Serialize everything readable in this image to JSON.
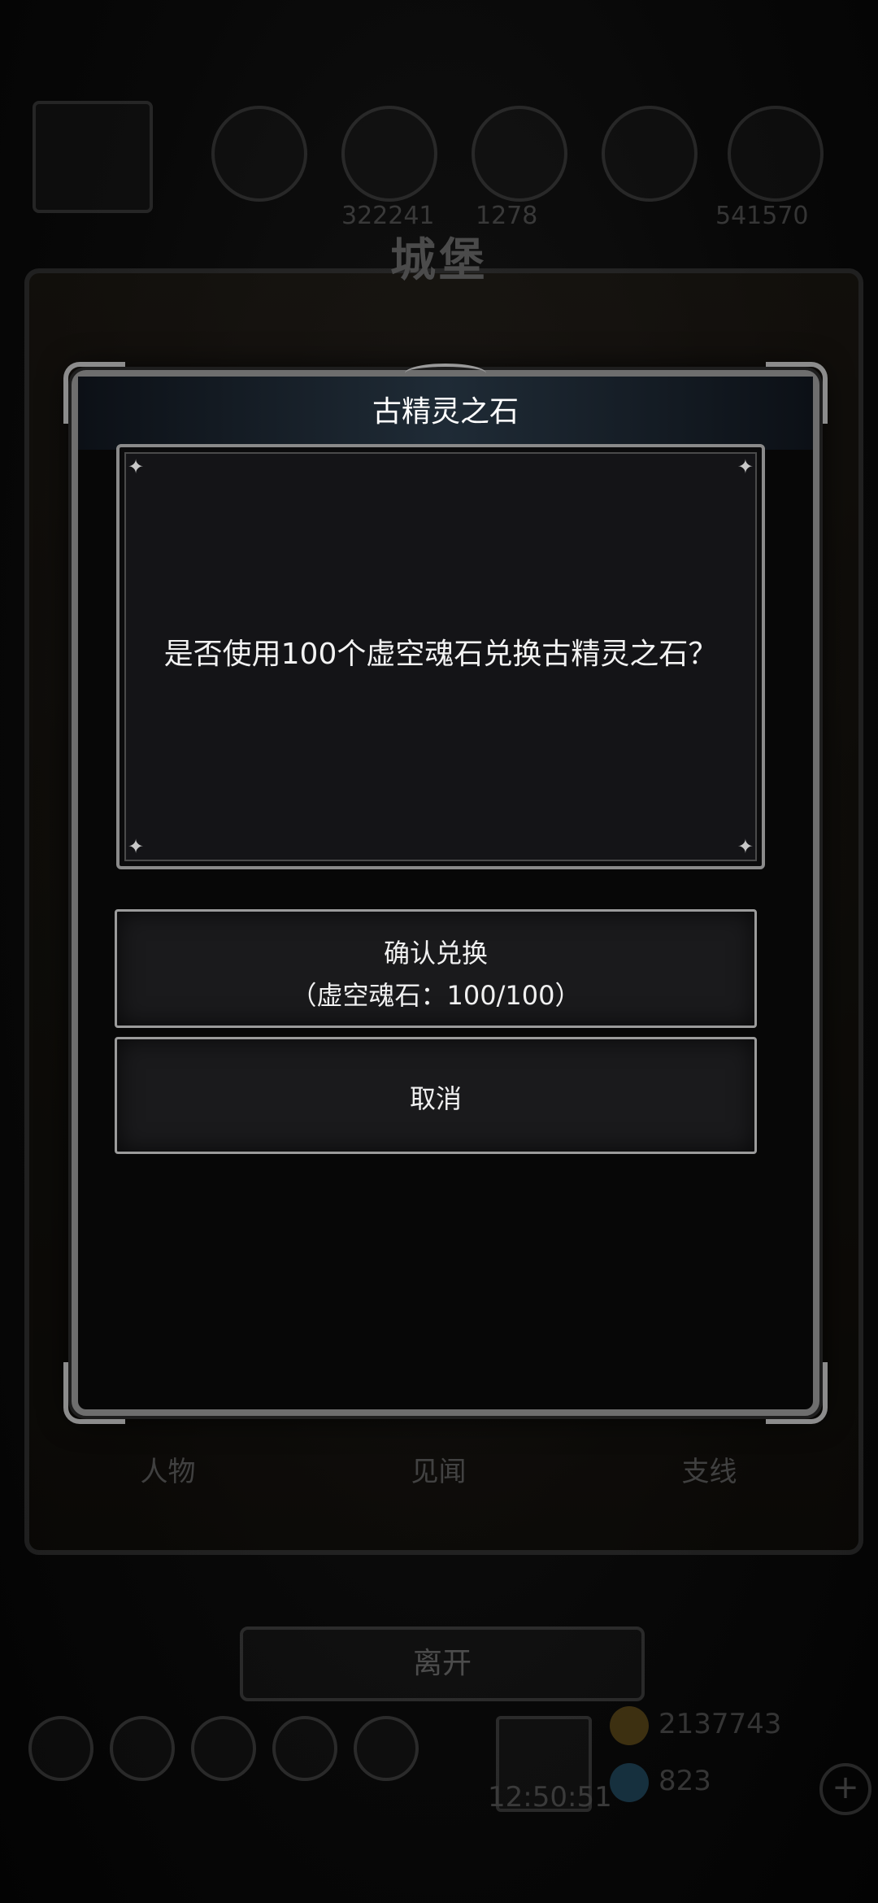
{
  "background": {
    "resources": [
      {
        "icon": "character-portrait-icon",
        "value": ""
      },
      {
        "icon": "ore-icon",
        "value": "322241"
      },
      {
        "icon": "lumber-icon",
        "value": "1278"
      },
      {
        "icon": "iron-icon",
        "value": ""
      },
      {
        "icon": "crystal-icon",
        "value": ""
      },
      {
        "icon": "anvil-icon",
        "value": "541570"
      }
    ],
    "castle_title": "城堡",
    "tabs": [
      "人物",
      "见闻",
      "支线"
    ],
    "leave_label": "离开",
    "clock": "12:50:51",
    "gold": "2137743",
    "gems": "823",
    "plus": "+"
  },
  "dialog": {
    "title": "古精灵之石",
    "message": "是否使用100个虚空魂石兑换古精灵之石？",
    "confirm_label": "确认兑换",
    "confirm_cost": "（虚空魂石：100/100）",
    "cancel_label": "取消"
  },
  "colors": {
    "dialog_border": "#6e6e6e",
    "title_bar": "#1f2b36",
    "text": "#f2f2f2"
  }
}
